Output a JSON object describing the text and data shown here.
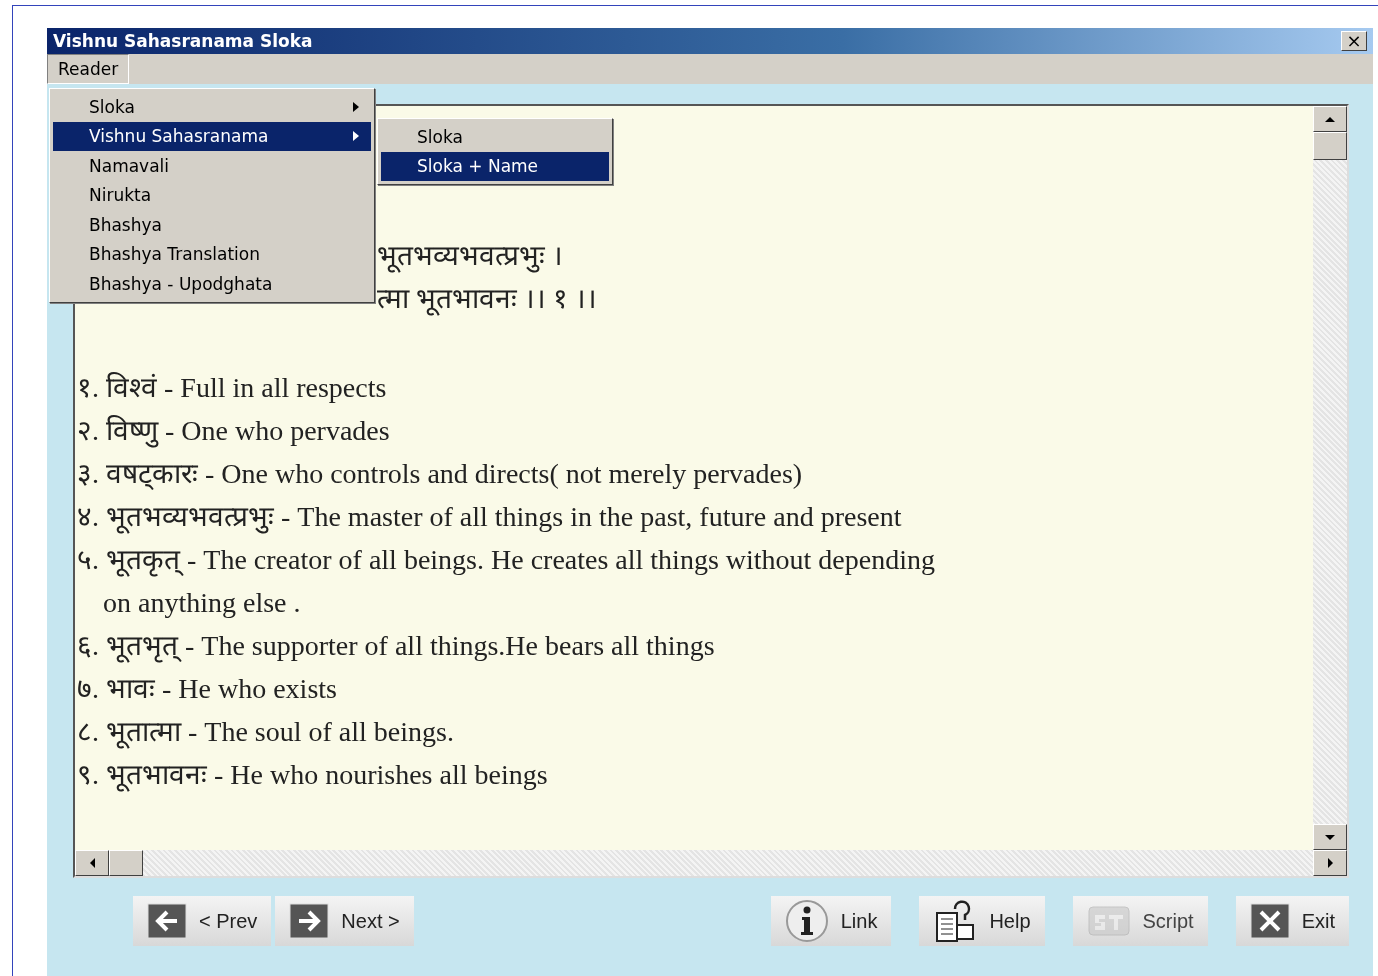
{
  "window": {
    "title": "Vishnu Sahasranama Sloka",
    "close": "×"
  },
  "menubar": [
    {
      "label": "Reader",
      "selected": true
    }
  ],
  "menu": [
    {
      "label": "Sloka",
      "selected": false,
      "submenu": true
    },
    {
      "label": "Vishnu Sahasranama",
      "selected": true,
      "submenu": true
    },
    {
      "label": "Namavali",
      "selected": false,
      "submenu": false
    },
    {
      "label": "Nirukta",
      "selected": false,
      "submenu": false
    },
    {
      "label": "Bhashya",
      "selected": false,
      "submenu": false
    },
    {
      "label": "Bhashya Translation",
      "selected": false,
      "submenu": false
    },
    {
      "label": "Bhashya - Upodghata",
      "selected": false,
      "submenu": false
    }
  ],
  "submenu": [
    {
      "label": "Sloka",
      "selected": false
    },
    {
      "label": "Sloka + Name",
      "selected": true
    }
  ],
  "sloka_lines": [
    "भूतभव्यभवत्प्रभुः ।",
    "त्मा भूतभावनः ।। १ ।।"
  ],
  "names": [
    {
      "number": "१.",
      "name": "विश्वं",
      "meaning": "- Full in all respects"
    },
    {
      "number": "२.",
      "name": "विष्णु",
      "meaning": "- One who pervades"
    },
    {
      "number": "३.",
      "name": "वषट्कारः",
      "meaning": "- One who controls and directs( not merely pervades)"
    },
    {
      "number": "४.",
      "name": "भूतभव्यभवत्प्रभुः",
      "meaning": "- The master of all things in the past, future and present"
    },
    {
      "number": "५.",
      "name": "भूतकृत्",
      "meaning": "- The creator of all beings. He creates all things without depending",
      "continuation": "on anything else ."
    },
    {
      "number": "६.",
      "name": "भूतभृत्",
      "meaning": "- The supporter of all things.He bears all things"
    },
    {
      "number": "७.",
      "name": "भावः",
      "meaning": "- He who exists"
    },
    {
      "number": "८.",
      "name": "भूतात्मा",
      "meaning": "- The soul of all beings."
    },
    {
      "number": "९.",
      "name": "भूतभावनः",
      "meaning": "- He who nourishes all beings"
    }
  ],
  "buttons": [
    {
      "kind": "prev",
      "label": "< Prev",
      "disabled": false
    },
    {
      "kind": "next",
      "label": "Next >",
      "disabled": false
    },
    {
      "kind": "link",
      "label": "Link",
      "disabled": false
    },
    {
      "kind": "help",
      "label": "Help",
      "disabled": false
    },
    {
      "kind": "script",
      "label": "Script",
      "disabled": true
    },
    {
      "kind": "exit",
      "label": "Exit",
      "disabled": false
    }
  ]
}
